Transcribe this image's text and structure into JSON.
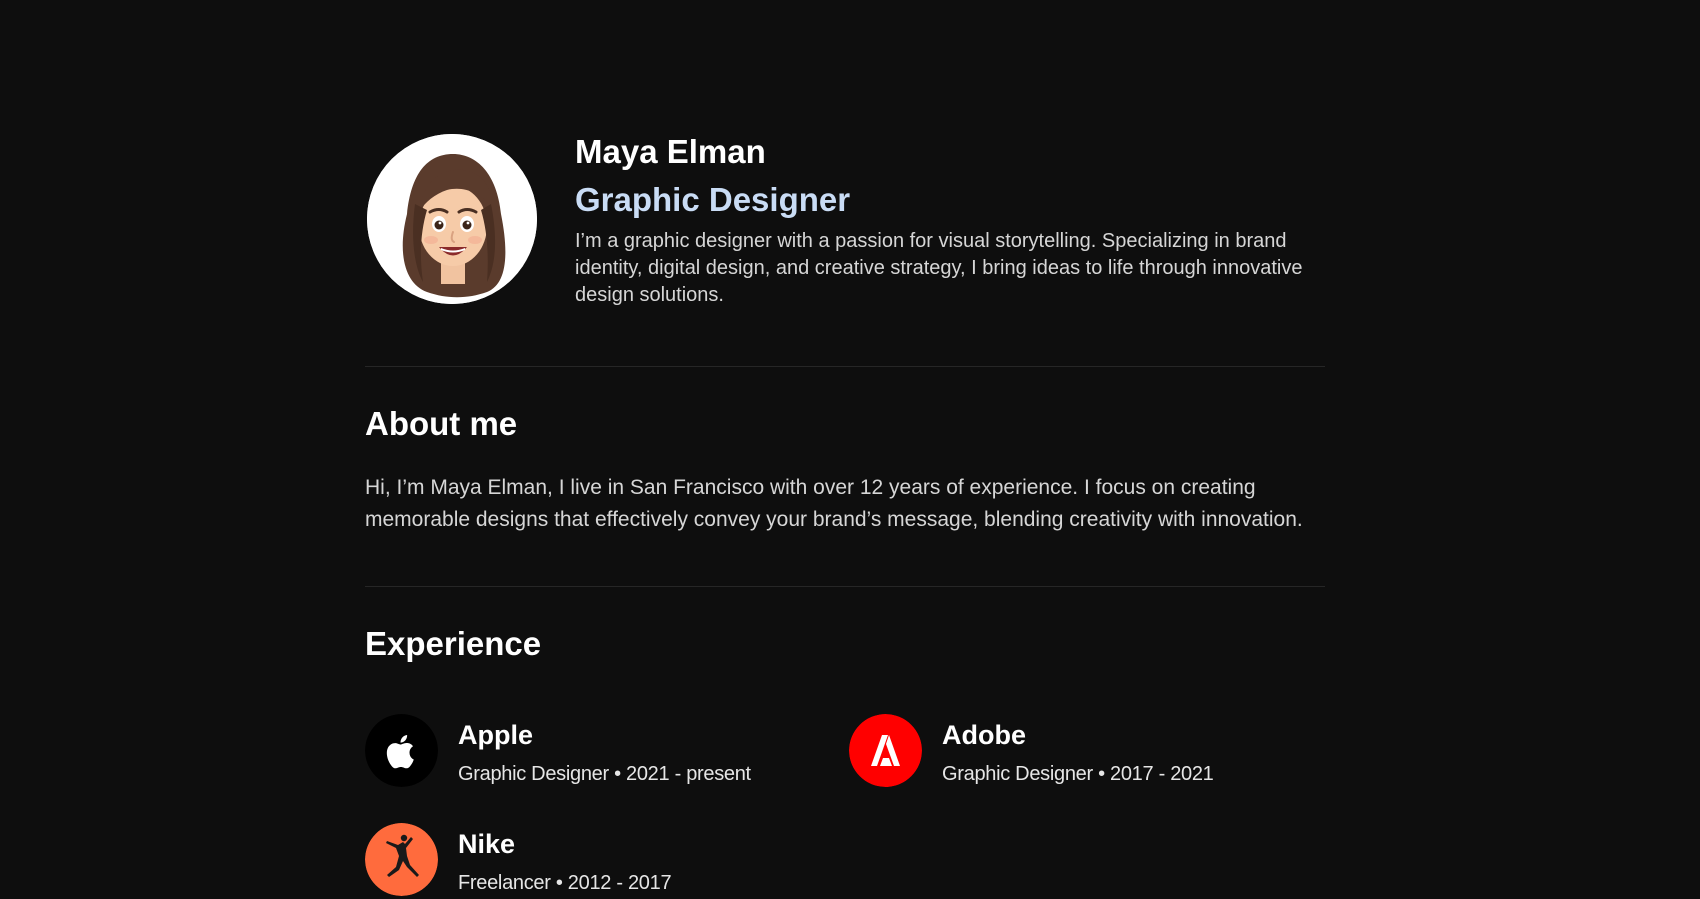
{
  "profile": {
    "name": "Maya Elman",
    "role": "Graphic Designer",
    "intro": "I’m a graphic designer with a passion for visual storytelling. Specializing in brand identity, digital design, and creative strategy, I bring ideas to life through innovative design solutions."
  },
  "about": {
    "title": "About me",
    "text": "Hi, I’m Maya Elman, I live in San Francisco with over 12 years of experience. I focus on creating memorable designs that effectively convey your brand’s message, blending creativity with innovation."
  },
  "experience": {
    "title": "Experience",
    "items": [
      {
        "company": "Apple",
        "meta": "Graphic Designer • 2021 - present",
        "icon": "apple-logo-icon",
        "color": "#000000"
      },
      {
        "company": "Adobe",
        "meta": "Graphic Designer • 2017 - 2021",
        "icon": "adobe-logo-icon",
        "color": "#ff0000"
      },
      {
        "company": "Nike",
        "meta": "Freelancer • 2012 - 2017",
        "icon": "jordan-jumpman-logo-icon",
        "color": "#ff6b3d"
      }
    ]
  },
  "colors": {
    "background": "#0e0e0e",
    "accent": "#c9dcf5",
    "text": "#d6d6d6"
  }
}
